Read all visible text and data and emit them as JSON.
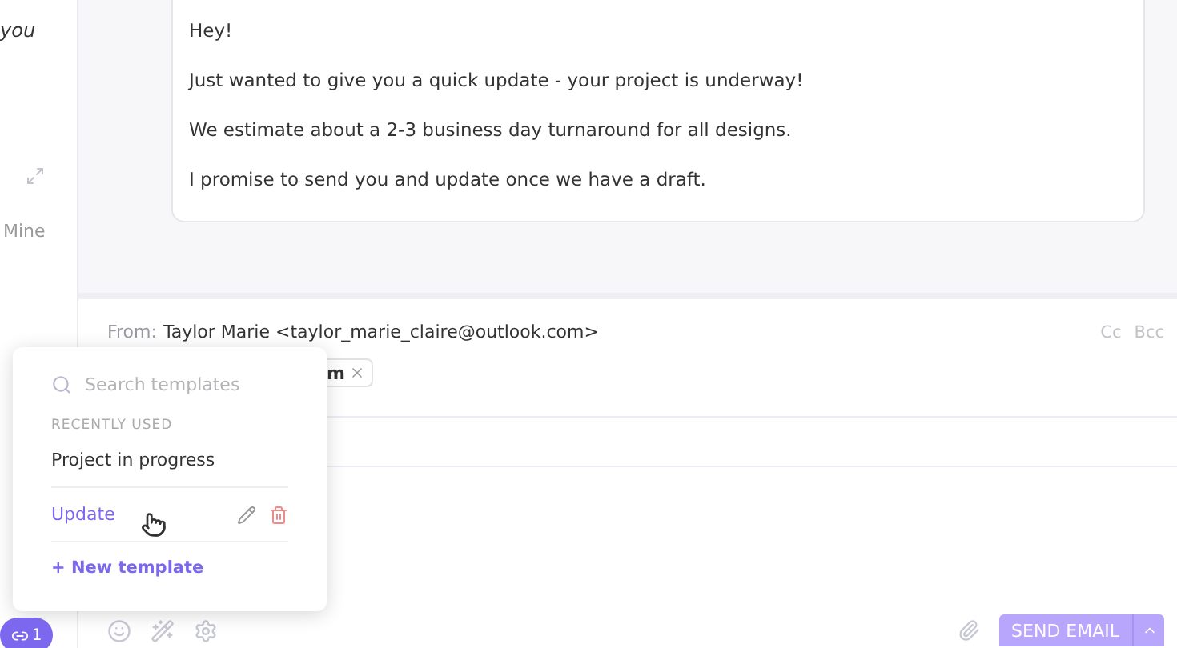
{
  "sidebar": {
    "snippet": "you",
    "tab": "Mine"
  },
  "message": {
    "lines": [
      "Hey!",
      "Just wanted to give you a quick update - your project is underway!",
      "We estimate about a 2-3 business day turnaround for all designs.",
      "I promise to send you and update once we have a draft."
    ]
  },
  "compose": {
    "from_label": "From:",
    "from": "Taylor Marie <taylor_marie_claire@outlook.com>",
    "cc": "Cc",
    "bcc": "Bcc",
    "recipient_chip": "m",
    "send": "SEND EMAIL"
  },
  "templates_menu": {
    "placeholder": "Search templates",
    "section": "RECENTLY USED",
    "items": [
      {
        "label": "Project in progress",
        "selected": false
      },
      {
        "label": "Update",
        "selected": true
      }
    ],
    "new_template": "+ New template"
  },
  "badge": {
    "count": "1"
  }
}
